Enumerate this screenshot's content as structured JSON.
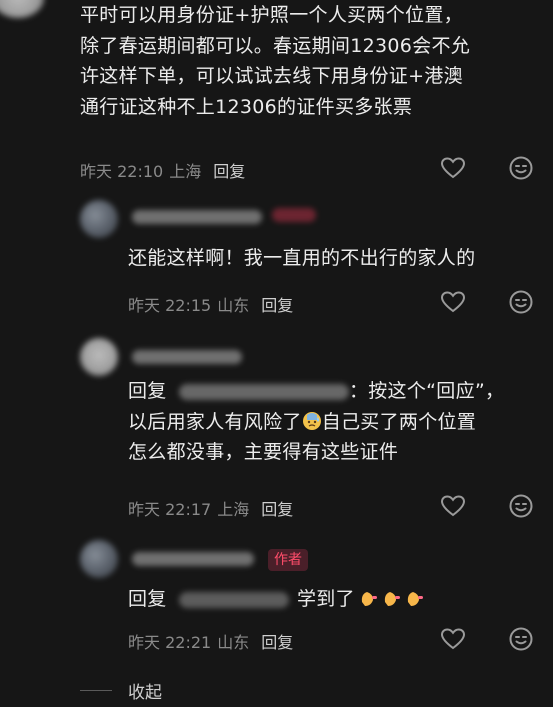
{
  "comments": [
    {
      "text_lines": [
        "平时可以用身份证+护照一个人买两个位置，",
        "除了春运期间都可以。春运期间12306会不允",
        "许这样下单，可以试试去线下用身份证+港澳",
        "通行证这种不上12306的证件买多张票"
      ],
      "time": "昨天 22:10",
      "location": "上海",
      "reply_label": "回复"
    },
    {
      "text_lines": [
        "还能这样啊！我一直用的不出行的家人的"
      ],
      "time": "昨天 22:15",
      "location": "山东",
      "reply_label": "回复"
    },
    {
      "reply_prefix": "回复",
      "quote_suffix": "：按这个“回应”，",
      "line2_a": "以后用家人有风险了",
      "line2_b": "自己买了两个位置",
      "line3": "怎么都没事，主要得有这些证件",
      "time": "昨天 22:17",
      "location": "上海",
      "reply_label": "回复"
    },
    {
      "author_badge": "作者",
      "reply_prefix": "回复",
      "text": "学到了",
      "time": "昨天 22:21",
      "location": "山东",
      "reply_label": "回复"
    }
  ],
  "collapse_label": "收起",
  "colors": {
    "background": "#161616",
    "text": "#ececec",
    "meta": "#8a8a8a",
    "author_badge": "#ff4d6a"
  },
  "icons": [
    "heart-icon",
    "comment-emoji-icon",
    "clapping-hands-emoji",
    "cold-sweat-emoji"
  ]
}
